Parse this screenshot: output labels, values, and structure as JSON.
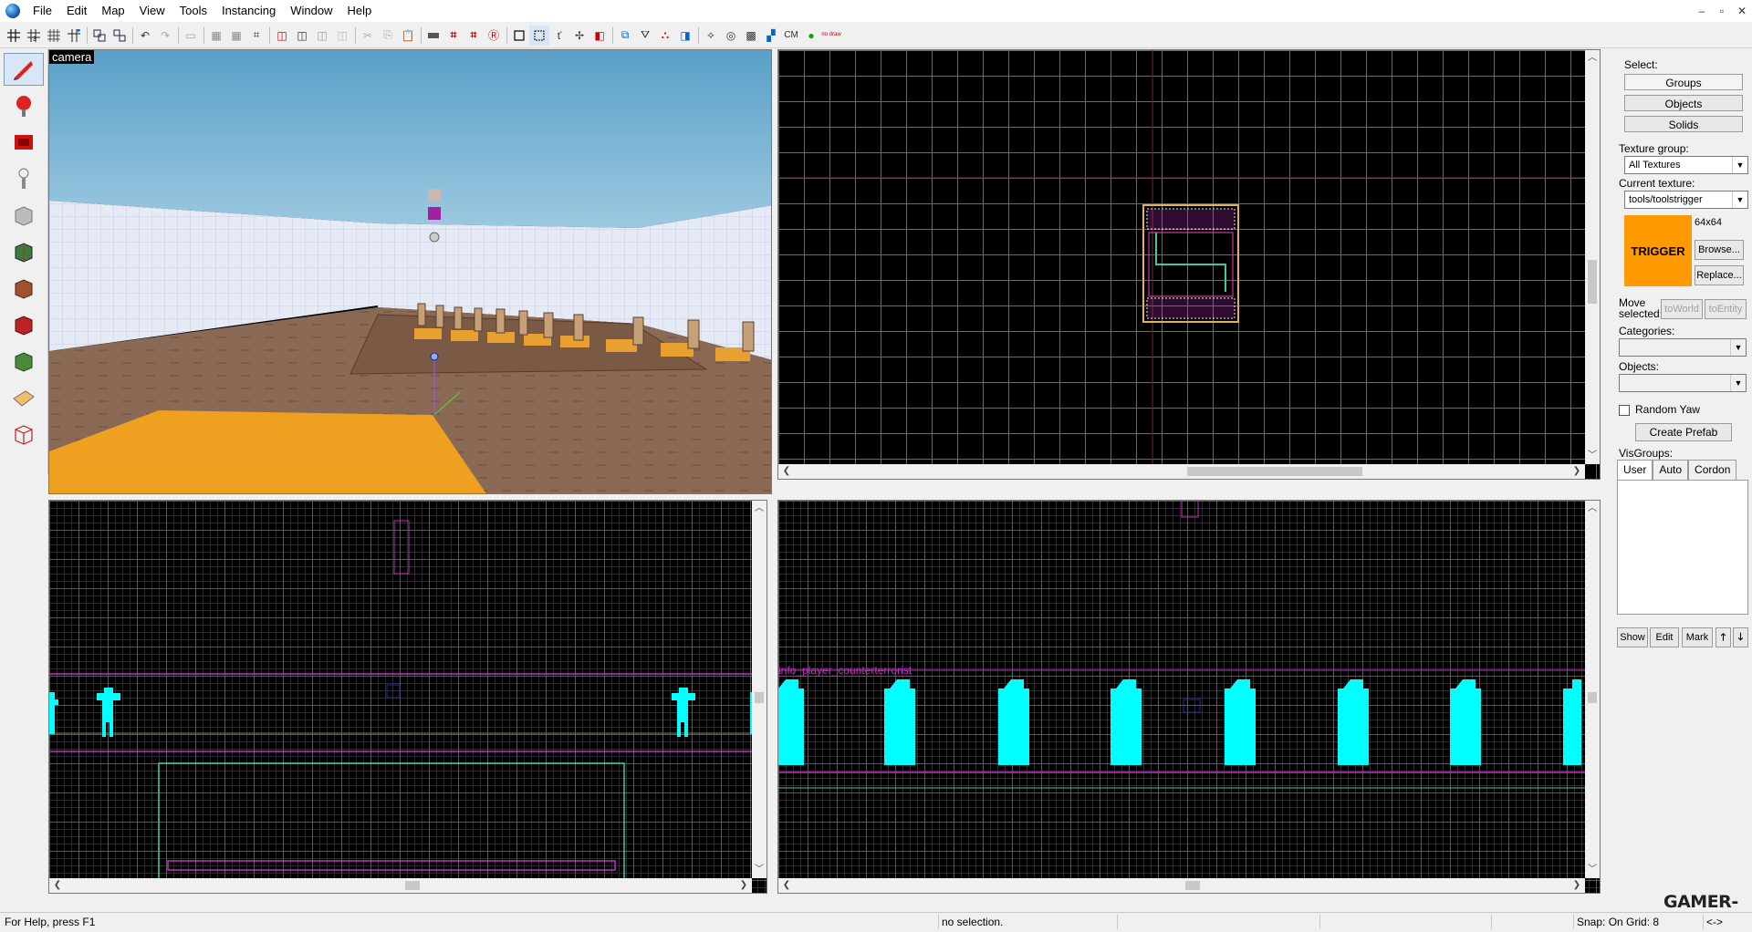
{
  "menu": {
    "items": [
      "File",
      "Edit",
      "Map",
      "View",
      "Tools",
      "Instancing",
      "Window",
      "Help"
    ]
  },
  "window_controls": [
    "–",
    "▫",
    "✕"
  ],
  "toolbar": {
    "cm_label": "CM",
    "nodraw_label": "no draw"
  },
  "viewports": {
    "camera_label": "camera",
    "entity_text": "info_player_counterterrorist"
  },
  "right_panel": {
    "select_label": "Select:",
    "groups_btn": "Groups",
    "objects_btn": "Objects",
    "solids_btn": "Solids",
    "texture_group_label": "Texture group:",
    "texture_group_value": "All Textures",
    "current_texture_label": "Current texture:",
    "current_texture_value": "tools/toolstrigger",
    "texture_preview_text": "TRIGGER",
    "texture_size": "64x64",
    "browse_btn": "Browse...",
    "replace_btn": "Replace...",
    "move_selected_label": "Move selected:",
    "to_world_btn": "toWorld",
    "to_entity_btn": "toEntity",
    "categories_label": "Categories:",
    "objects_label": "Objects:",
    "random_yaw_label": "Random Yaw",
    "create_prefab_btn": "Create Prefab",
    "visgroups_label": "VisGroups:",
    "tabs": [
      "User",
      "Auto",
      "Cordon"
    ],
    "show_btn": "Show",
    "edit_btn": "Edit",
    "mark_btn": "Mark",
    "up_btn": "🡑",
    "down_btn": "🡓"
  },
  "status": {
    "help": "For Help, press F1",
    "selection": "no selection.",
    "snap": "Snap: On Grid: 8",
    "coords": "<->"
  },
  "watermark": "GAMER-LAB.COM",
  "colors": {
    "entity_cyan": "#00ffff",
    "brush_magenta": "#ff00ff",
    "brush_green": "#40c8a0",
    "trigger_orange": "#ff9a00"
  }
}
